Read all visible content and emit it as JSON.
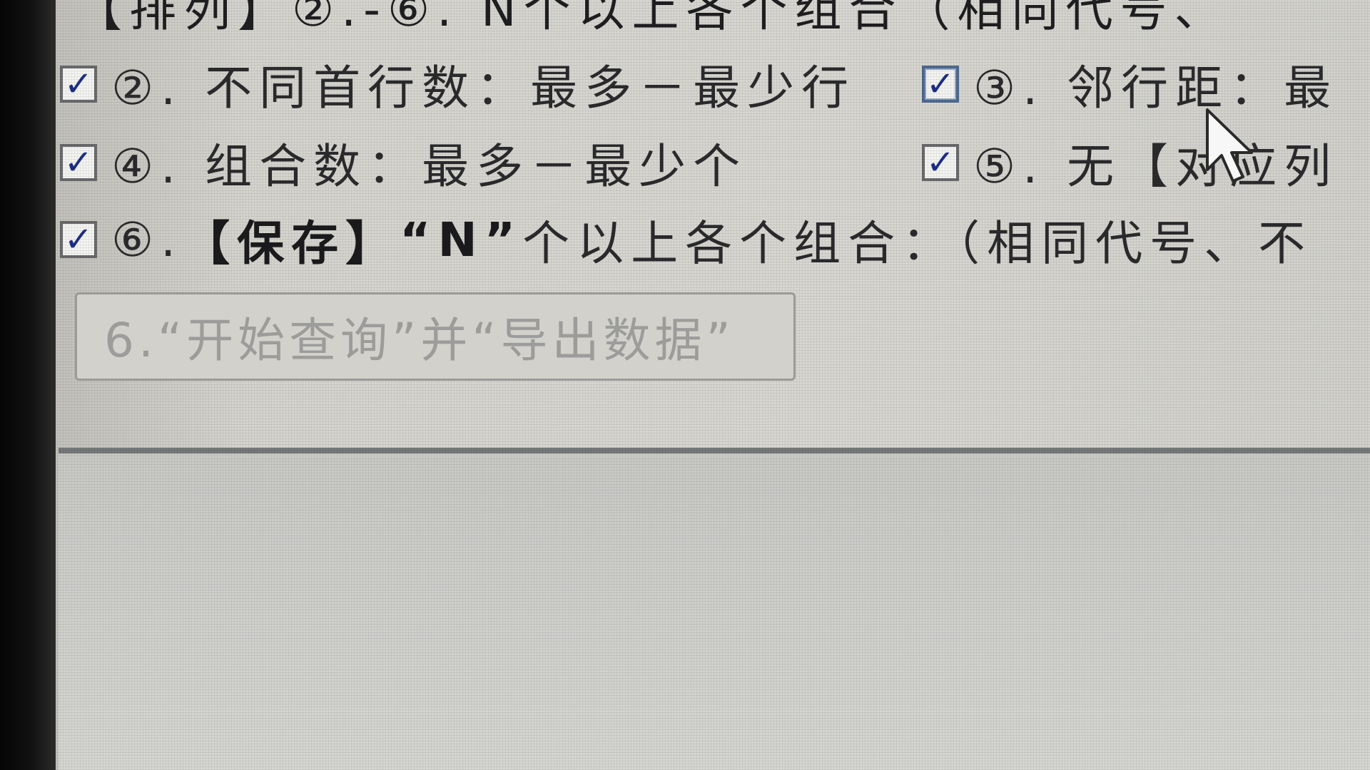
{
  "top_row_partial": "【排列】②.-⑥. N个以上各个组合（相同代号、",
  "options": {
    "opt2": {
      "label": "②. 不同首行数：最多－最少行",
      "checked": true
    },
    "opt3": {
      "label": "③. 邻行距：最",
      "checked": true
    },
    "opt4": {
      "label": "④. 组合数：最多－最少个",
      "checked": true
    },
    "opt5": {
      "label": "⑤. 无【对应列",
      "checked": true
    },
    "opt6": {
      "prefix": "⑥.",
      "save_label": "【保存】",
      "quoted_n": "“N”",
      "suffix": "个以上各个组合：（相同代号、不",
      "checked": true
    }
  },
  "check_glyph": "✓",
  "export_button_label": "6.“开始查询”并“导出数据”",
  "icons": {
    "checkbox": "checkbox-checked-icon",
    "cursor": "mouse-pointer-icon"
  },
  "colors": {
    "text": "#2b2b2d",
    "check": "#1d2f86",
    "disabled_text": "#9c9c9a",
    "divider": "#77787a"
  }
}
